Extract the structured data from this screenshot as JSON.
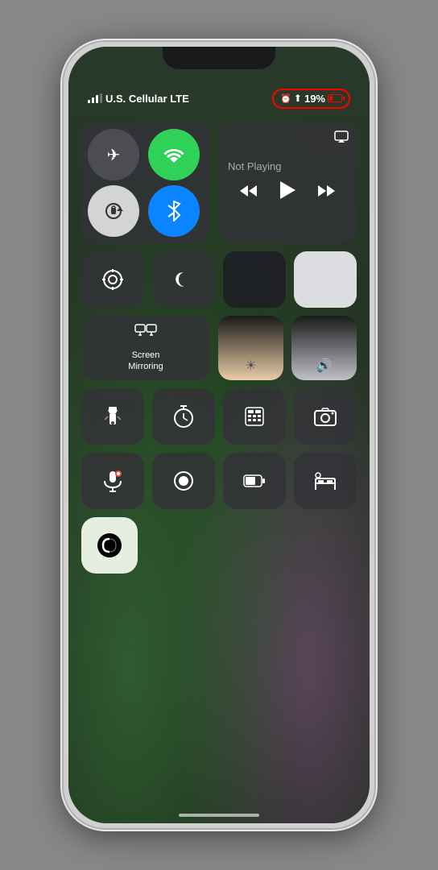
{
  "status_bar": {
    "carrier": "U.S. Cellular LTE",
    "alarm_icon": "⏰",
    "location_icon": "➤",
    "battery_percent": "19%",
    "signal_bars": 3
  },
  "now_playing": {
    "label": "Not Playing",
    "airplay_icon": "⊙"
  },
  "controls": {
    "airplane_mode": "✈",
    "wifi_active": "((•))",
    "rotation_lock": "⊕",
    "do_not_disturb": "☽",
    "screen_mirroring_label": "Screen\nMirroring",
    "screen_mirroring_icon": "⬜",
    "brightness_icon": "☀",
    "volume_icon": "🔊",
    "flashlight_icon": "🔦",
    "timer_icon": "⏱",
    "calculator_icon": "⌨",
    "camera_icon": "📷",
    "voice_memo_icon": "🎤",
    "screen_record_icon": "⏺",
    "battery_case_icon": "🔋",
    "bed_icon": "🛏",
    "accessibility_icon": "◑"
  },
  "media_controls": {
    "rewind": "«",
    "play": "▶",
    "forward": "»"
  }
}
